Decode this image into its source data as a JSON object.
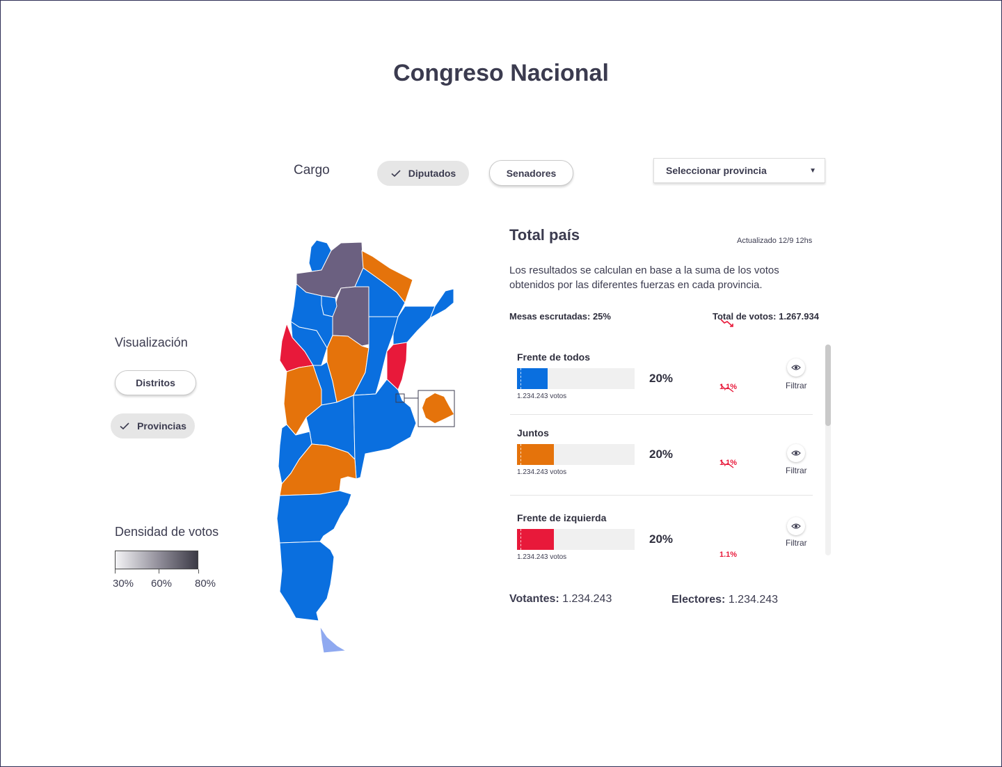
{
  "page_title": "Congreso Nacional",
  "cargo": {
    "label": "Cargo",
    "options": [
      {
        "label": "Diputados",
        "selected": true
      },
      {
        "label": "Senadores",
        "selected": false
      }
    ],
    "province_select": "Seleccionar provincia"
  },
  "visualization": {
    "label": "Visualización",
    "options": [
      {
        "label": "Distritos",
        "selected": false
      },
      {
        "label": "Provincias",
        "selected": true
      }
    ]
  },
  "density": {
    "label": "Densidad de votos",
    "ticks": [
      "30%",
      "60%",
      "80%"
    ]
  },
  "summary": {
    "title": "Total país",
    "updated": "Actualizado 12/9 12hs",
    "description": "Los resultados se calculan en base a la suma de los votos obtenidos por las diferentes fuerzas en cada provincia.",
    "mesas": "Mesas escrutadas: 25%",
    "total_votos": "Total de votos: 1.267.934"
  },
  "parties": [
    {
      "name": "Frente de todos",
      "percent": "20%",
      "percent_value": 20,
      "votes": "1.234.243 votos",
      "delta": "1,1%",
      "color": "#0a6fdf",
      "filter_label": "Filtrar"
    },
    {
      "name": "Juntos",
      "percent": "20%",
      "percent_value": 20,
      "votes": "1.234.243 votos",
      "delta": "1,1%",
      "color": "#e5730b",
      "filter_label": "Filtrar"
    },
    {
      "name": "Frente de izquierda",
      "percent": "20%",
      "percent_value": 20,
      "votes": "1.234.243 votos",
      "delta": "1.1%",
      "color": "#e8193a",
      "filter_label": "Filtrar"
    }
  ],
  "footer": {
    "votantes_label": "Votantes:",
    "votantes_value": "1.234.243",
    "electores_label": "Electores:",
    "electores_value": "1.234.243"
  },
  "colors": {
    "blue": "#0a6fdf",
    "orange": "#e5730b",
    "red": "#e8193a",
    "purple": "#6b6080",
    "light_blue": "#8fa9f0"
  }
}
